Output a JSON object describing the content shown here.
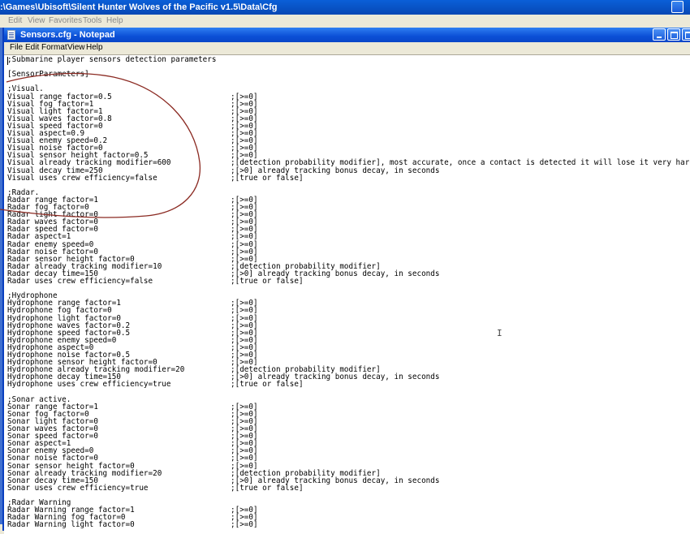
{
  "background_window": {
    "title": ":\\Games\\Ubisoft\\Silent Hunter Wolves of the Pacific v1.5\\Data\\Cfg",
    "menu": [
      "Edit",
      "View",
      "Favorites",
      "Tools",
      "Help"
    ]
  },
  "notepad": {
    "title": "Sensors.cfg - Notepad",
    "menu": [
      "File",
      "Edit",
      "Format",
      "View",
      "Help"
    ],
    "lines": [
      {
        "left": ";Submarine player sensors detection parameters",
        "right": ""
      },
      {
        "left": "",
        "right": ""
      },
      {
        "left": "[SensorParameters]",
        "right": ""
      },
      {
        "left": "",
        "right": ""
      },
      {
        "left": ";Visual.",
        "right": ""
      },
      {
        "left": "Visual range factor=0.5",
        "right": ";[>=0]"
      },
      {
        "left": "Visual fog factor=1",
        "right": ";[>=0]"
      },
      {
        "left": "Visual light factor=1",
        "right": ";[>=0]"
      },
      {
        "left": "Visual waves factor=0.8",
        "right": ";[>=0]"
      },
      {
        "left": "Visual speed factor=0",
        "right": ";[>=0]"
      },
      {
        "left": "Visual aspect=0.9",
        "right": ";[>=0]"
      },
      {
        "left": "Visual enemy speed=0.2",
        "right": ";[>=0]"
      },
      {
        "left": "Visual noise factor=0",
        "right": ";[>=0]"
      },
      {
        "left": "Visual sensor height factor=0.5",
        "right": ";[>=0]"
      },
      {
        "left": "Visual already tracking modifier=600",
        "right": ";[detection probability modifier], most accurate, once a contact is detected it will lose it very hard"
      },
      {
        "left": "Visual decay time=250",
        "right": ";[>0] already tracking bonus decay, in seconds"
      },
      {
        "left": "Visual uses crew efficiency=false",
        "right": ";[true or false]"
      },
      {
        "left": "",
        "right": ""
      },
      {
        "left": ";Radar.",
        "right": ""
      },
      {
        "left": "Radar range factor=1",
        "right": ";[>=0]"
      },
      {
        "left": "Radar fog factor=0",
        "right": ";[>=0]"
      },
      {
        "left": "Radar light factor=0",
        "right": ";[>=0]"
      },
      {
        "left": "Radar waves factor=0",
        "right": ";[>=0]"
      },
      {
        "left": "Radar speed factor=0",
        "right": ";[>=0]"
      },
      {
        "left": "Radar aspect=1",
        "right": ";[>=0]"
      },
      {
        "left": "Radar enemy speed=0",
        "right": ";[>=0]"
      },
      {
        "left": "Radar noise factor=0",
        "right": ";[>=0]"
      },
      {
        "left": "Radar sensor height factor=0",
        "right": ";[>=0]"
      },
      {
        "left": "Radar already tracking modifier=10",
        "right": ";[detection probability modifier]"
      },
      {
        "left": "Radar decay time=150",
        "right": ";[>0] already tracking bonus decay, in seconds"
      },
      {
        "left": "Radar uses crew efficiency=false",
        "right": ";[true or false]"
      },
      {
        "left": "",
        "right": ""
      },
      {
        "left": ";Hydrophone",
        "right": ""
      },
      {
        "left": "Hydrophone range factor=1",
        "right": ";[>=0]"
      },
      {
        "left": "Hydrophone fog factor=0",
        "right": ";[>=0]"
      },
      {
        "left": "Hydrophone light factor=0",
        "right": ";[>=0]"
      },
      {
        "left": "Hydrophone waves factor=0.2",
        "right": ";[>=0]"
      },
      {
        "left": "Hydrophone speed factor=0.5",
        "right": ";[>=0]"
      },
      {
        "left": "Hydrophone enemy speed=0",
        "right": ";[>=0]"
      },
      {
        "left": "Hydrophone aspect=0",
        "right": ";[>=0]"
      },
      {
        "left": "Hydrophone noise factor=0.5",
        "right": ";[>=0]"
      },
      {
        "left": "Hydrophone sensor height factor=0",
        "right": ";[>=0]"
      },
      {
        "left": "Hydrophone already tracking modifier=20",
        "right": ";[detection probability modifier]"
      },
      {
        "left": "Hydrophone decay time=150",
        "right": ";[>0] already tracking bonus decay, in seconds"
      },
      {
        "left": "Hydrophone uses crew efficiency=true",
        "right": ";[true or false]"
      },
      {
        "left": "",
        "right": ""
      },
      {
        "left": ";Sonar active.",
        "right": ""
      },
      {
        "left": "Sonar range factor=1",
        "right": ";[>=0]"
      },
      {
        "left": "Sonar fog factor=0",
        "right": ";[>=0]"
      },
      {
        "left": "Sonar light factor=0",
        "right": ";[>=0]"
      },
      {
        "left": "Sonar waves factor=0",
        "right": ";[>=0]"
      },
      {
        "left": "Sonar speed factor=0",
        "right": ";[>=0]"
      },
      {
        "left": "Sonar aspect=1",
        "right": ";[>=0]"
      },
      {
        "left": "Sonar enemy speed=0",
        "right": ";[>=0]"
      },
      {
        "left": "Sonar noise factor=0",
        "right": ";[>=0]"
      },
      {
        "left": "Sonar sensor height factor=0",
        "right": ";[>=0]"
      },
      {
        "left": "Sonar already tracking modifier=20",
        "right": ";[detection probability modifier]"
      },
      {
        "left": "Sonar decay time=150",
        "right": ";[>0] already tracking bonus decay, in seconds"
      },
      {
        "left": "Sonar uses crew efficiency=true",
        "right": ";[true or false]"
      },
      {
        "left": "",
        "right": ""
      },
      {
        "left": ";Radar Warning",
        "right": ""
      },
      {
        "left": "Radar Warning range factor=1",
        "right": ";[>=0]"
      },
      {
        "left": "Radar Warning fog factor=0",
        "right": ";[>=0]"
      },
      {
        "left": "Radar Warning light factor=0",
        "right": ";[>=0]"
      }
    ]
  },
  "colors": {
    "title_blue": "#0b4fd6",
    "annotation": "#8b2a22"
  }
}
